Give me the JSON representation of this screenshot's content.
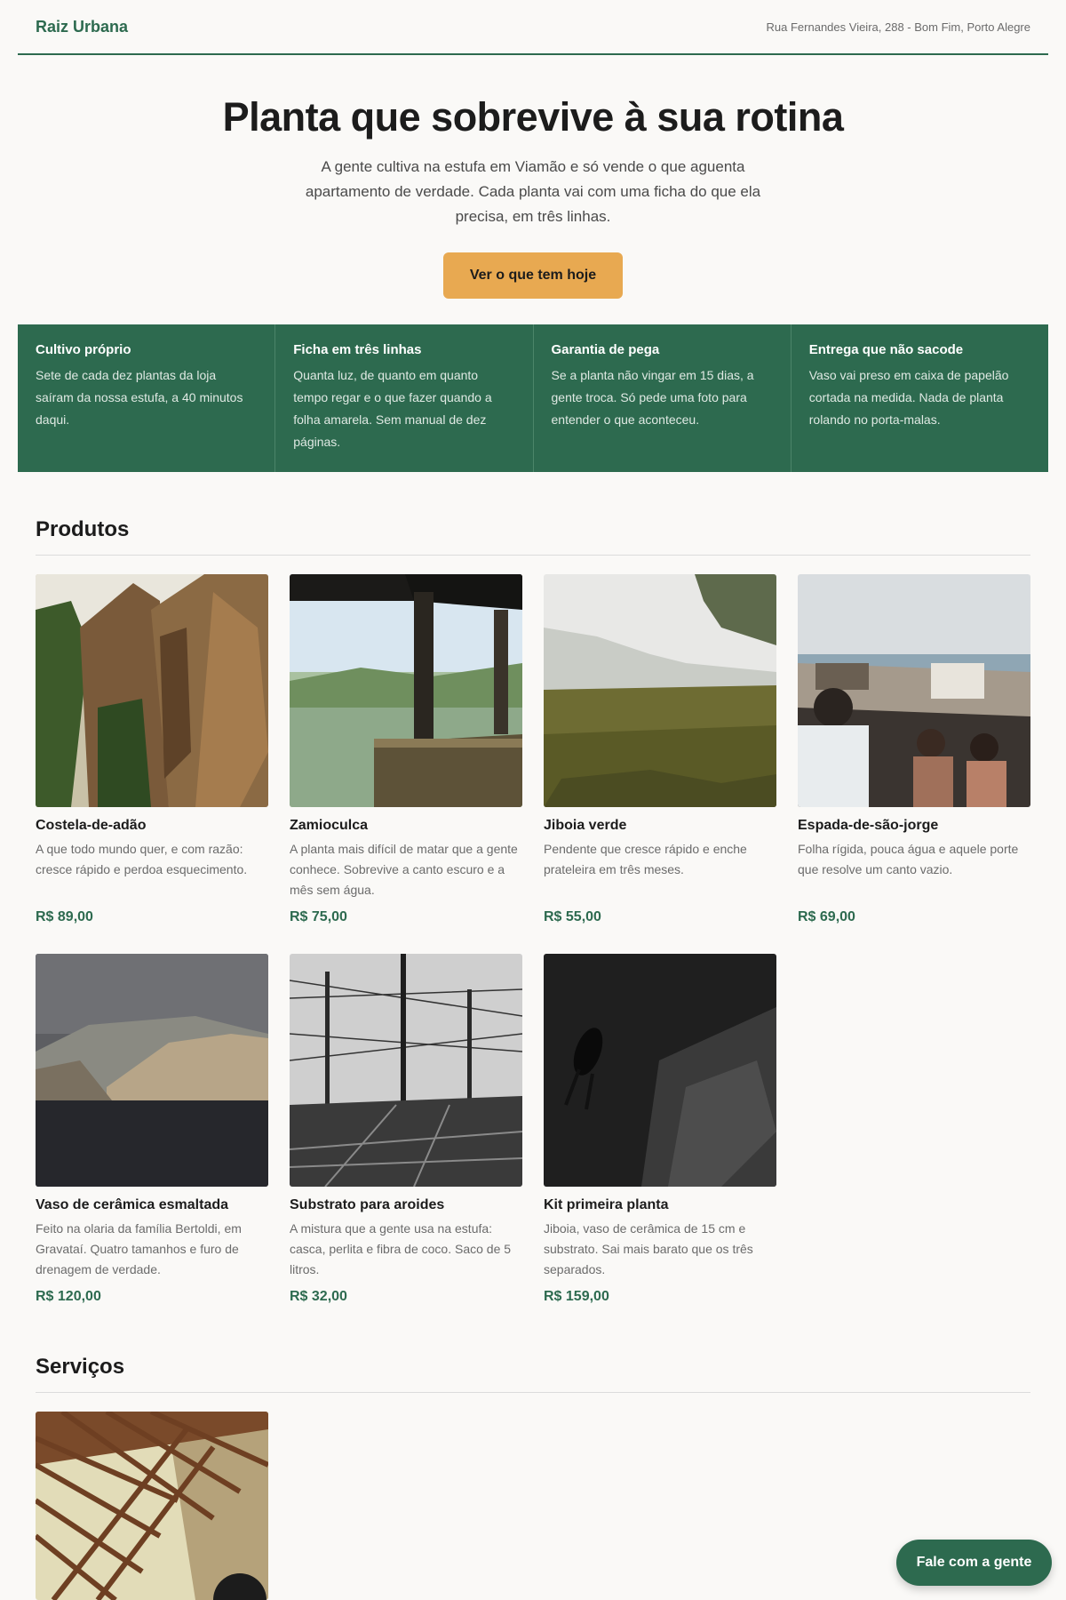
{
  "header": {
    "brand": "Raiz Urbana",
    "address": "Rua Fernandes Vieira, 288 - Bom Fim, Porto Alegre"
  },
  "hero": {
    "title": "Planta que sobrevive à sua rotina",
    "subtitle": "A gente cultiva na estufa em Viamão e só vende o que aguenta apartamento de verdade. Cada planta vai com uma ficha do que ela precisa, em três linhas.",
    "cta_label": "Ver o que tem hoje"
  },
  "features": [
    {
      "title": "Cultivo próprio",
      "text": "Sete de cada dez plantas da loja saíram da nossa estufa, a 40 minutos daqui."
    },
    {
      "title": "Ficha em três linhas",
      "text": "Quanta luz, de quanto em quanto tempo regar e o que fazer quando a folha amarela. Sem manual de dez páginas."
    },
    {
      "title": "Garantia de pega",
      "text": "Se a planta não vingar em 15 dias, a gente troca. Só pede uma foto para entender o que aconteceu."
    },
    {
      "title": "Entrega que não sacode",
      "text": "Vaso vai preso em caixa de papelão cortada na medida. Nada de planta rolando no porta-malas."
    }
  ],
  "products_section": {
    "title": "Produtos",
    "items": [
      {
        "name": "Costela-de-adão",
        "desc": "A que todo mundo quer, e com razão: cresce rápido e perdoa esquecimento.",
        "price": "R$ 89,00",
        "image": "rock-cliff-forest-photo"
      },
      {
        "name": "Zamioculca",
        "desc": "A planta mais difícil de matar que a gente conhece. Sobrevive a canto escuro e a mês sem água.",
        "price": "R$ 75,00",
        "image": "misty-lake-pier-photo"
      },
      {
        "name": "Jiboia verde",
        "desc": "Pendente que cresce rápido e enche prateleira em três meses.",
        "price": "R$ 55,00",
        "image": "foggy-meadow-photo"
      },
      {
        "name": "Espada-de-são-jorge",
        "desc": "Folha rígida, pouca água e aquele porte que resolve um canto vazio.",
        "price": "R$ 69,00",
        "image": "crowded-boardwalk-photo"
      },
      {
        "name": "Vaso de cerâmica esmaltada",
        "desc": "Feito na olaria da família Bertoldi, em Gravataí. Quatro tamanhos e furo de drenagem de verdade.",
        "price": "R$ 120,00",
        "image": "coastal-cliffs-photo"
      },
      {
        "name": "Substrato para aroides",
        "desc": "A mistura que a gente usa na estufa: casca, perlita e fibra de coco. Saco de 5 litros.",
        "price": "R$ 32,00",
        "image": "railway-wires-photo"
      },
      {
        "name": "Kit primeira planta",
        "desc": "Jiboia, vaso de cerâmica de 15 cm e substrato. Sai mais barato que os três separados.",
        "price": "R$ 159,00",
        "image": "scuba-diver-photo"
      }
    ]
  },
  "services_section": {
    "title": "Serviços",
    "items": [
      {
        "image": "steel-bridge-photo"
      }
    ]
  },
  "chat": {
    "label": "Fale com a gente"
  },
  "colors": {
    "brand_green": "#2d6a4f",
    "accent_orange": "#e8a951",
    "background": "#faf9f7"
  }
}
